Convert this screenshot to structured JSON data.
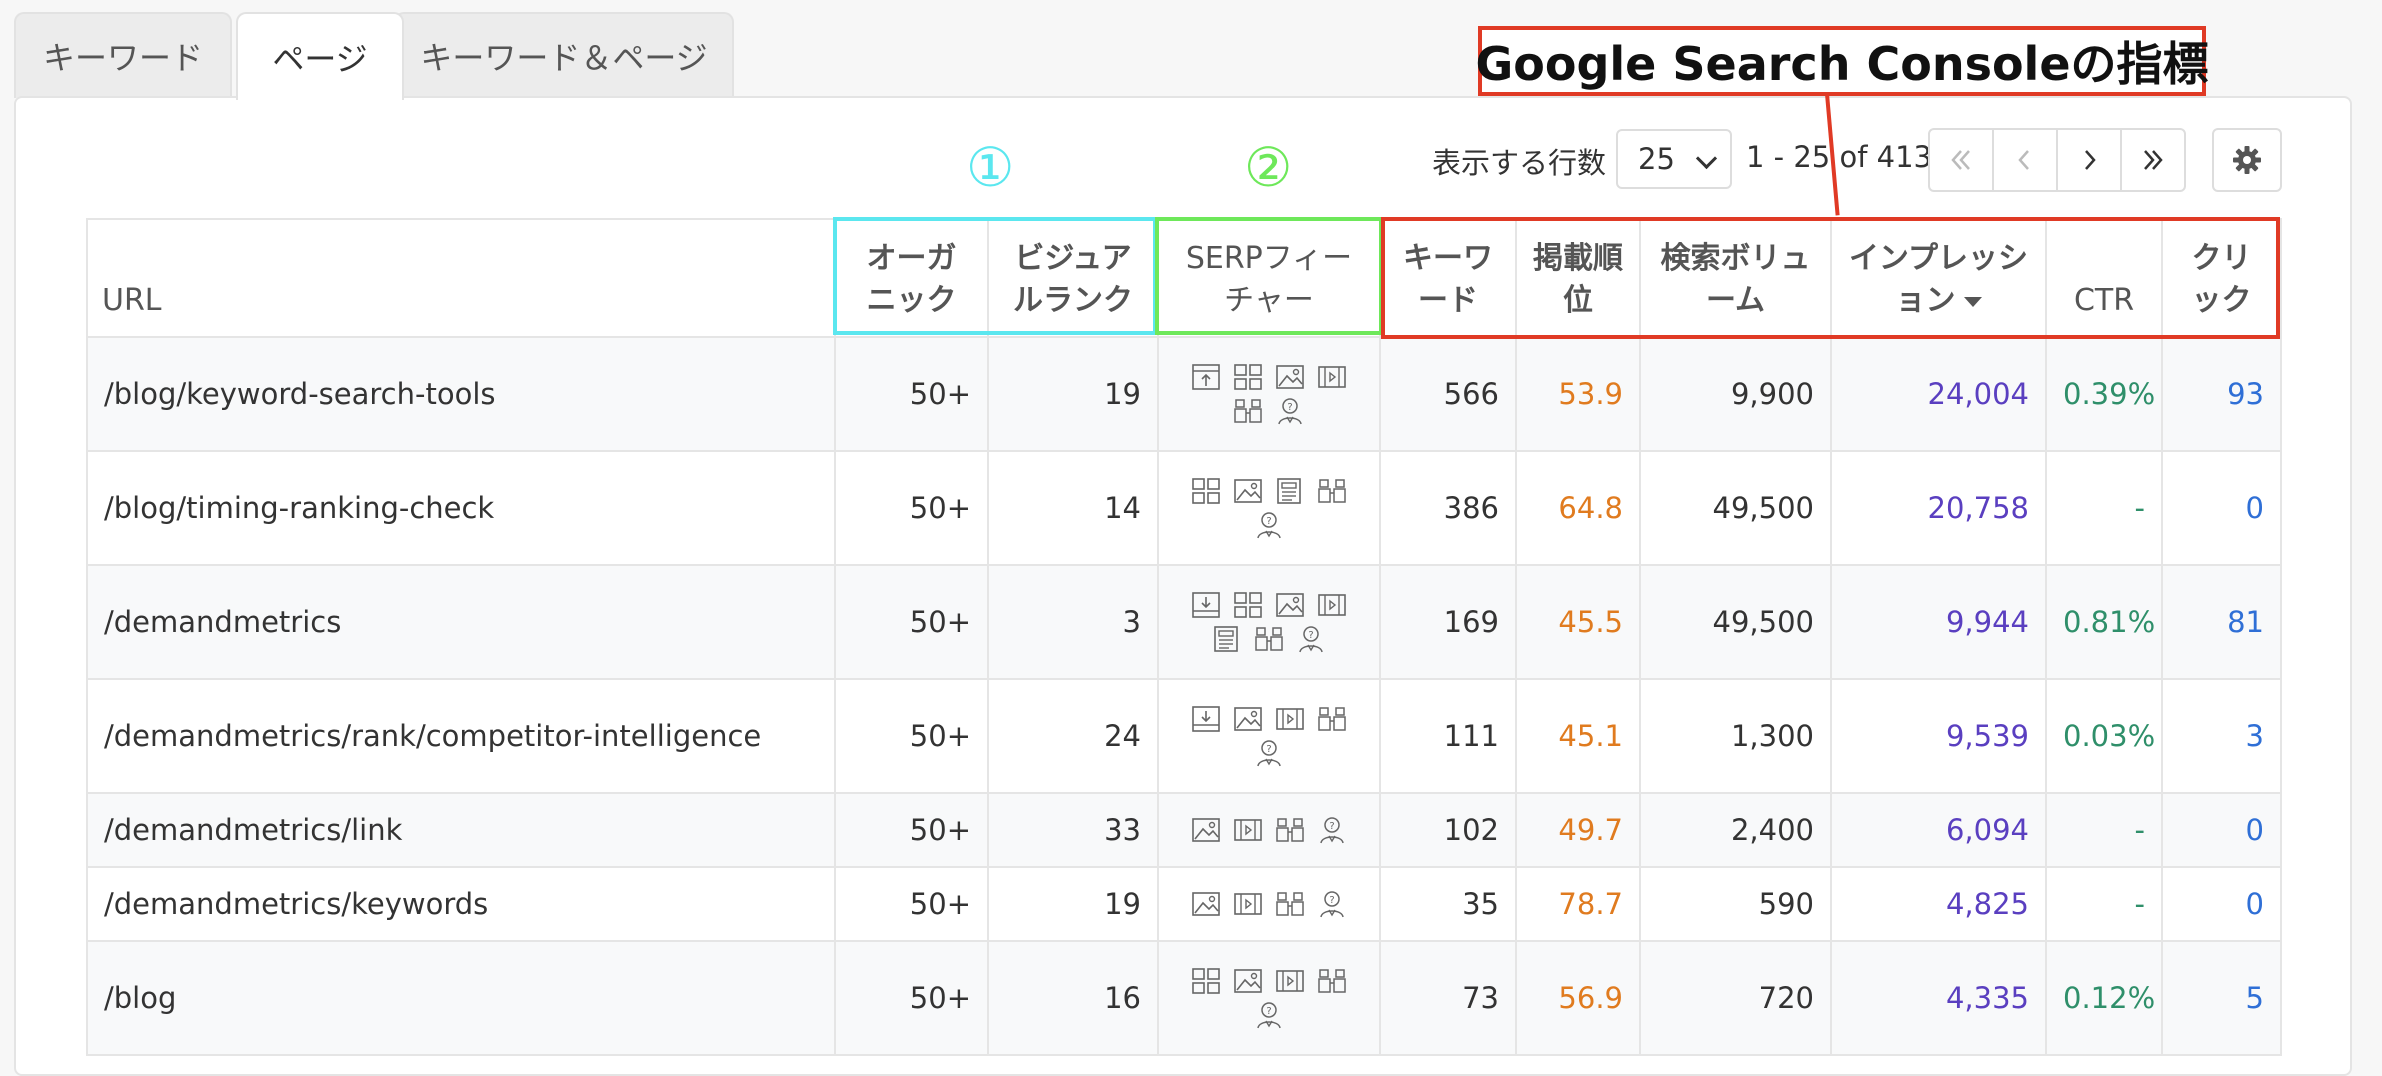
{
  "tabs": [
    {
      "label": "キーワード",
      "active": false
    },
    {
      "label": "ページ",
      "active": true
    },
    {
      "label": "キーワード＆ページ",
      "active": false
    }
  ],
  "controls": {
    "rows_label": "表示する行数",
    "rows_value": "25",
    "range_text": "1 - 25 of 413",
    "pager": [
      "first",
      "prev",
      "next",
      "last"
    ],
    "settings_icon": "gear-icon"
  },
  "annotations": {
    "num1": "①",
    "num2": "②",
    "gsc_title": "Google Search Consoleの指標",
    "color_cyan": "#5be7ef",
    "color_green": "#6ee85a",
    "color_red": "#e03a25"
  },
  "table": {
    "headers": {
      "url": "URL",
      "organic_1": "オーガ",
      "organic_2": "ニック",
      "visual_1": "ビジュア",
      "visual_2": "ルランク",
      "serp_1": "SERPフィー",
      "serp_2": "チャー",
      "kw_1": "キーワ",
      "kw_2": "ード",
      "pos_1": "掲載順",
      "pos_2": "位",
      "vol_1": "検索ボリュ",
      "vol_2": "ーム",
      "imp_1": "インプレッシ",
      "imp_2": "ョン",
      "ctr": "CTR",
      "clk_1": "クリ",
      "clk_2": "ック"
    },
    "rows": [
      {
        "url": "/blog/keyword-search-tools",
        "organic": "50+",
        "visual": "19",
        "features": [
          "featured-snippet",
          "image-pack",
          "images",
          "video",
          "related-questions",
          "people-also-ask"
        ],
        "keywords": "566",
        "position": "53.9",
        "volume": "9,900",
        "impressions": "24,004",
        "ctr": "0.39%",
        "clicks": "93"
      },
      {
        "url": "/blog/timing-ranking-check",
        "organic": "50+",
        "visual": "14",
        "features": [
          "image-pack",
          "images",
          "news",
          "related-questions",
          "people-also-ask"
        ],
        "keywords": "386",
        "position": "64.8",
        "volume": "49,500",
        "impressions": "20,758",
        "ctr": "-",
        "clicks": "0"
      },
      {
        "url": "/demandmetrics",
        "organic": "50+",
        "visual": "3",
        "features": [
          "sitelinks",
          "image-pack",
          "images",
          "video",
          "news",
          "related-questions",
          "people-also-ask"
        ],
        "keywords": "169",
        "position": "45.5",
        "volume": "49,500",
        "impressions": "9,944",
        "ctr": "0.81%",
        "clicks": "81"
      },
      {
        "url": "/demandmetrics/rank/competitor-intelligence",
        "organic": "50+",
        "visual": "24",
        "features": [
          "sitelinks",
          "images",
          "video",
          "related-questions",
          "people-also-ask"
        ],
        "keywords": "111",
        "position": "45.1",
        "volume": "1,300",
        "impressions": "9,539",
        "ctr": "0.03%",
        "clicks": "3"
      },
      {
        "url": "/demandmetrics/link",
        "organic": "50+",
        "visual": "33",
        "features": [
          "images",
          "video",
          "related-questions",
          "people-also-ask"
        ],
        "keywords": "102",
        "position": "49.7",
        "volume": "2,400",
        "impressions": "6,094",
        "ctr": "-",
        "clicks": "0"
      },
      {
        "url": "/demandmetrics/keywords",
        "organic": "50+",
        "visual": "19",
        "features": [
          "images",
          "video",
          "related-questions",
          "people-also-ask"
        ],
        "keywords": "35",
        "position": "78.7",
        "volume": "590",
        "impressions": "4,825",
        "ctr": "-",
        "clicks": "0"
      },
      {
        "url": "/blog",
        "organic": "50+",
        "visual": "16",
        "features": [
          "image-pack",
          "images",
          "video",
          "related-questions",
          "people-also-ask"
        ],
        "keywords": "73",
        "position": "56.9",
        "volume": "720",
        "impressions": "4,335",
        "ctr": "0.12%",
        "clicks": "5"
      }
    ]
  }
}
